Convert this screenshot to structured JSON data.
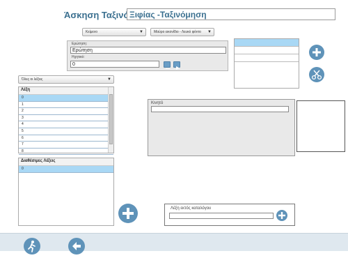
{
  "title": {
    "label": "Άσκηση Ταξινόμησης:",
    "value": "Ξιφίας -Ταξινόμηση"
  },
  "dropdowns": {
    "mode": "Κείμενο",
    "level": "Μαύρο εικονίδιο - Λευκό φόντο"
  },
  "question_panel": {
    "question_label": "Ερώτηση:",
    "question_value": "Ερώτηση",
    "sound_label": "Ηχητικό:",
    "sound_value": "0"
  },
  "answers_list": {
    "rows": [
      "",
      "",
      ""
    ],
    "selected_index": 0
  },
  "words": {
    "filter": "Όλες οι λέξεις",
    "header": "Λέξη",
    "items": [
      "0",
      "1",
      "2",
      "3",
      "4",
      "5",
      "6",
      "7",
      "8"
    ],
    "selected_index": 0
  },
  "available_words": {
    "header": "Διαθέσιμες Λέξεις",
    "items": [
      "0"
    ]
  },
  "text_panel": {
    "label": "Κινητό",
    "value": ""
  },
  "out_of_catalog": {
    "label": "Λέξη εκτός καταλόγου",
    "value": ""
  },
  "icons": {
    "add": "plus-circle-icon",
    "delete": "scissors-icon",
    "exit": "running-man-icon",
    "back": "arrow-left-icon"
  },
  "colors": {
    "accent": "#5f93b9",
    "title": "#3a6f8f",
    "selection": "#a9d8f5",
    "footer": "#dfe8ef"
  }
}
